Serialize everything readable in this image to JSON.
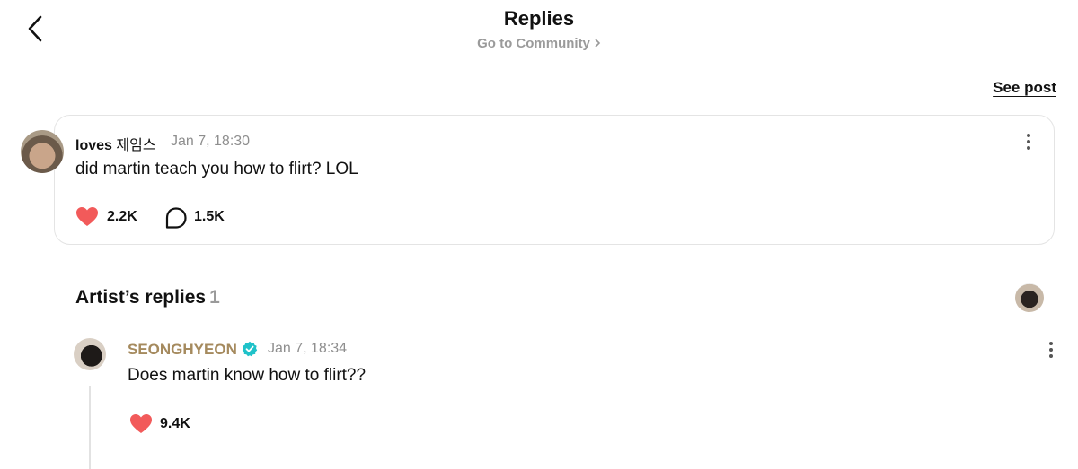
{
  "header": {
    "title": "Replies",
    "community_link": "Go to Community",
    "see_post": "See post"
  },
  "post": {
    "author_name": "loves",
    "author_name_kr": "제임스",
    "timestamp": "Jan 7, 18:30",
    "text": "did martin teach you how to flirt? LOL",
    "likes": "2.2K",
    "comments": "1.5K"
  },
  "artist_replies": {
    "title": "Artist’s replies",
    "count": "1"
  },
  "reply": {
    "author": "SEONGHYEON",
    "timestamp": "Jan 7, 18:34",
    "text": "Does martin know how to flirt??",
    "likes": "9.4K"
  },
  "colors": {
    "heart": "#f25a5a",
    "artist_name": "#a58a5e",
    "verified": "#1fc2c9",
    "muted": "#8e8e8e"
  },
  "icons": {
    "back": "chevron-left-icon",
    "community": "chevron-right-icon",
    "more": "more-vertical-icon",
    "like": "heart-icon",
    "comment": "comment-bubble-icon",
    "verified": "verified-badge-icon"
  }
}
